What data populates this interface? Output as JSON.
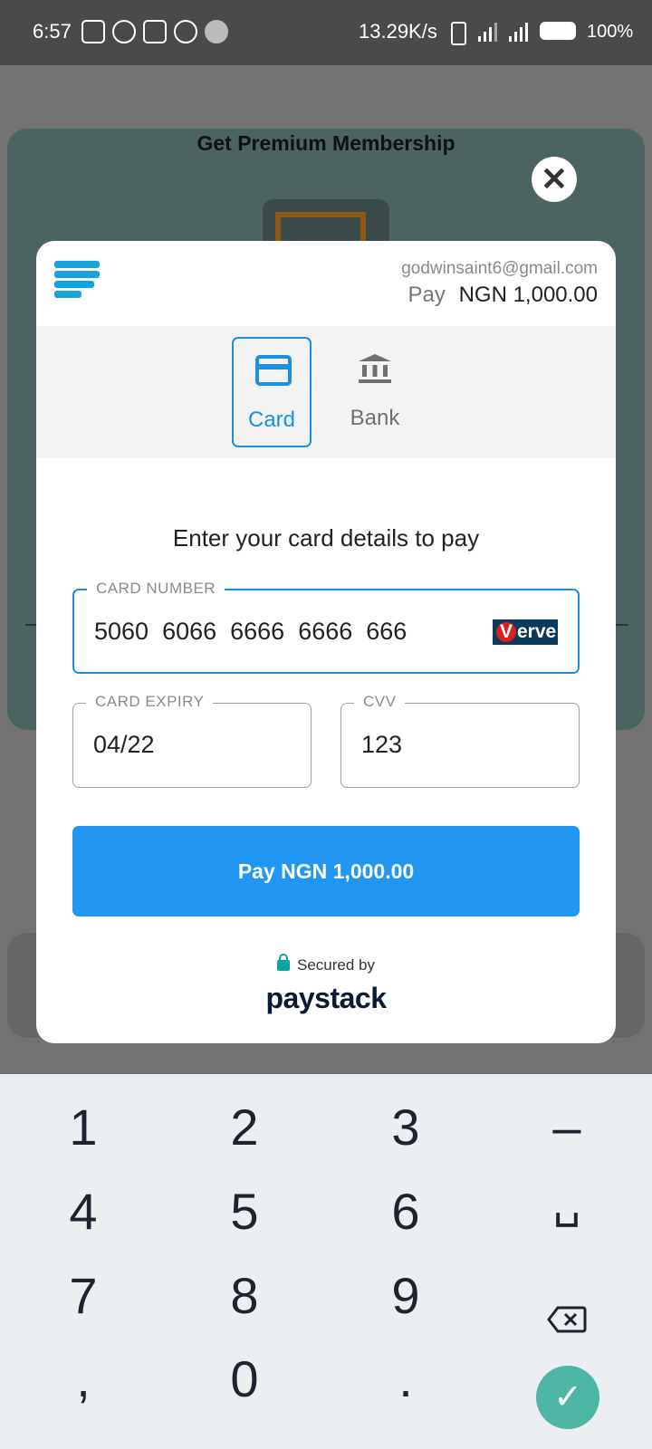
{
  "status_bar": {
    "time": "6:57",
    "speed": "13.29K/s",
    "battery": "100%"
  },
  "background": {
    "title": "Get Premium Membership",
    "close_symbol": "✕"
  },
  "modal": {
    "email": "godwinsaint6@gmail.com",
    "pay_label": "Pay",
    "amount": "NGN 1,000.00",
    "tabs": [
      {
        "label": "Card",
        "icon": "credit-card-icon",
        "active": true
      },
      {
        "label": "Bank",
        "icon": "bank-icon",
        "active": false
      }
    ],
    "instructions": "Enter your card details to pay",
    "card_number": {
      "label": "CARD NUMBER",
      "value": "5060  6066  6666  6666  666"
    },
    "card_brand": "Verve",
    "card_expiry": {
      "label": "CARD EXPIRY",
      "value": "04/22"
    },
    "cvv": {
      "label": "CVV",
      "value": "123"
    },
    "pay_button": "Pay NGN 1,000.00",
    "secured_by": "Secured by",
    "provider": "paystack"
  },
  "keypad": {
    "keys": [
      "1",
      "2",
      "3",
      "–",
      "4",
      "5",
      "6",
      "␣",
      "7",
      "8",
      "9",
      ",",
      "0",
      "."
    ],
    "accent": "#4db6a4"
  },
  "colors": {
    "accent_blue": "#2196f3",
    "paystack_blue": "#17a3db",
    "background_teal": "#4c6461"
  }
}
